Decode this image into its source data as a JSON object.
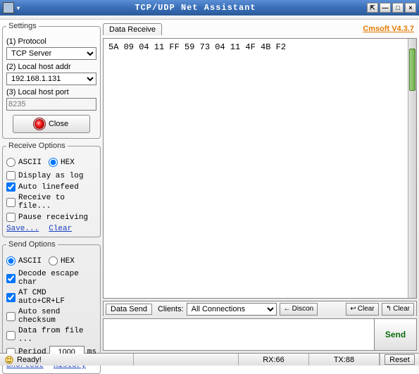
{
  "window": {
    "title": "TCP/UDP Net Assistant",
    "brand": "Cmsoft V4.3.7"
  },
  "settings": {
    "legend": "Settings",
    "protocol_label": "(1) Protocol",
    "protocol_value": "TCP Server",
    "host_label": "(2) Local host addr",
    "host_value": "192.168.1.131",
    "port_label": "(3) Local host port",
    "port_value": "8235",
    "close_label": "Close"
  },
  "recv_opts": {
    "legend": "Receive Options",
    "ascii": "ASCII",
    "hex": "HEX",
    "display_log": "Display as log",
    "auto_linefeed": "Auto linefeed",
    "recv_to_file": "Receive to file...",
    "pause_recv": "Pause receiving",
    "save": "Save...",
    "clear": "Clear"
  },
  "send_opts": {
    "legend": "Send Options",
    "ascii": "ASCII",
    "hex": "HEX",
    "decode_escape": "Decode escape char",
    "at_cmd": "AT CMD auto+CR+LF",
    "auto_checksum": "Auto send checksum",
    "data_from_file": "Data from file ...",
    "period": "Period",
    "period_value": "1000",
    "period_unit": "ms",
    "shortcut": "Shortcut",
    "history": "History"
  },
  "recv": {
    "tab": "Data Receive",
    "content": "5A 09 04 11 FF 59 73 04 11 4F 4B F2"
  },
  "send": {
    "tab": "Data Send",
    "clients_label": "Clients:",
    "clients_value": "All Connections",
    "discon": "Discon",
    "clear1": "Clear",
    "clear2": "Clear",
    "send_btn": "Send"
  },
  "status": {
    "ready": "Ready!",
    "rx": "RX:66",
    "tx": "TX:88",
    "reset": "Reset"
  }
}
